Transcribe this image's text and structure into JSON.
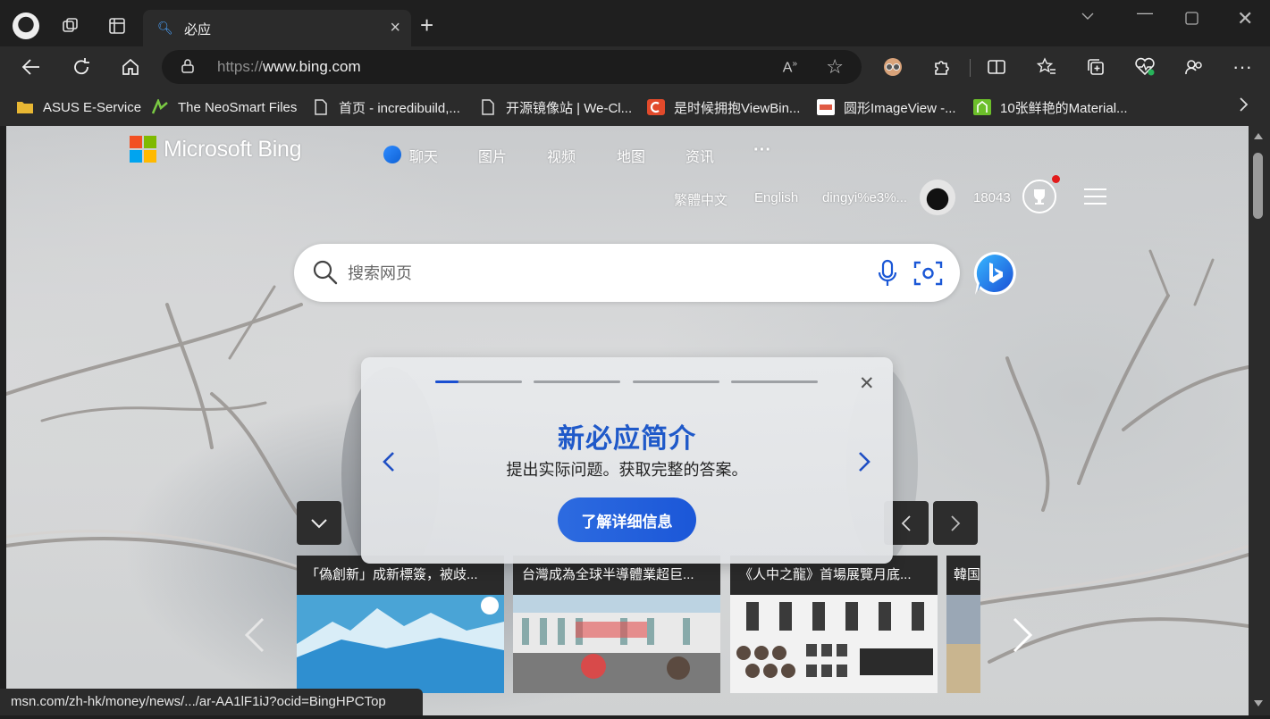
{
  "tab": {
    "title": "必应"
  },
  "address": {
    "prefix": "https://",
    "host": "www.bing.com"
  },
  "bookmarks": [
    {
      "label": "ASUS E-Service",
      "icon": "folder-icon"
    },
    {
      "label": "The NeoSmart Files",
      "icon": "neosmart-icon"
    },
    {
      "label": "首页 - incredibuild,...",
      "icon": "page-icon"
    },
    {
      "label": "开源镜像站 | We-Cl...",
      "icon": "page-icon"
    },
    {
      "label": "是时候拥抱ViewBin...",
      "icon": "csdn-icon"
    },
    {
      "label": "圆形ImageView -...",
      "icon": "jianshu-icon"
    },
    {
      "label": "10张鲜艳的Material...",
      "icon": "material-icon"
    }
  ],
  "bing": {
    "logo_text": "Microsoft Bing",
    "nav": [
      "聊天",
      "图片",
      "视频",
      "地图",
      "资讯"
    ],
    "more": "···",
    "lang_trad": "繁體中文",
    "lang_en": "English",
    "username": "dingyi%e3%...",
    "points": "18043",
    "search_placeholder": "搜索网页"
  },
  "intro": {
    "title": "新必应简介",
    "subtitle": "提出实际问题。获取完整的答案。",
    "button": "了解详细信息",
    "progress_steps": 4,
    "current_step": 1
  },
  "news": [
    {
      "caption": "「偽創新」成新標簽，被歧..."
    },
    {
      "caption": "台灣成為全球半導體業超巨..."
    },
    {
      "caption": "《人中之龍》首場展覽月底..."
    },
    {
      "caption": "韓国"
    }
  ],
  "status_url": "msn.com/zh-hk/money/news/.../ar-AA1lF1iJ?ocid=BingHPCTop",
  "colors": {
    "accent": "#1f59c9",
    "button": "#2d6be0",
    "chrome": "#1f1f1f"
  }
}
